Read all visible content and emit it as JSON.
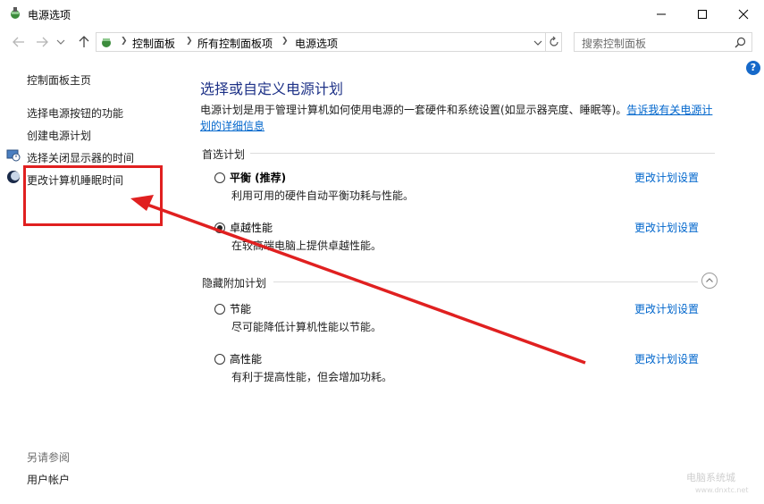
{
  "window": {
    "title": "电源选项",
    "minimize_icon": "minimize-icon",
    "maximize_icon": "maximize-icon",
    "close_icon": "close-icon"
  },
  "address": {
    "crumbs": [
      "控制面板",
      "所有控制面板项",
      "电源选项"
    ],
    "search_placeholder": "搜索控制面板"
  },
  "sidebar": {
    "home": "控制面板主页",
    "items": [
      "选择电源按钮的功能",
      "创建电源计划",
      "选择关闭显示器的时间",
      "更改计算机睡眠时间"
    ],
    "see_also_label": "另请参阅",
    "see_also_items": [
      "用户帐户"
    ]
  },
  "main": {
    "title": "选择或自定义电源计划",
    "description": "电源计划是用于管理计算机如何使用电源的一套硬件和系统设置(如显示器亮度、睡眠等)。",
    "description_link": "告诉我有关电源计划的详细信息",
    "preferred_label": "首选计划",
    "hidden_label": "隐藏附加计划",
    "change_link": "更改计划设置",
    "plans": [
      {
        "name": "平衡 (推荐)",
        "desc": "利用可用的硬件自动平衡功耗与性能。",
        "selected": false
      },
      {
        "name": "卓越性能",
        "desc": "在较高端电脑上提供卓越性能。",
        "selected": true
      },
      {
        "name": "节能",
        "desc": "尽可能降低计算机性能以节能。",
        "selected": false
      },
      {
        "name": "高性能",
        "desc": "有利于提高性能，但会增加功耗。",
        "selected": false
      }
    ]
  },
  "help_icon": "?",
  "watermark": "电脑系统城",
  "watermark_url": "www.dnxtc.net",
  "colors": {
    "link": "#0066cc",
    "title": "#1e3287",
    "annotation": "#e02020",
    "help": "#1669c9"
  }
}
